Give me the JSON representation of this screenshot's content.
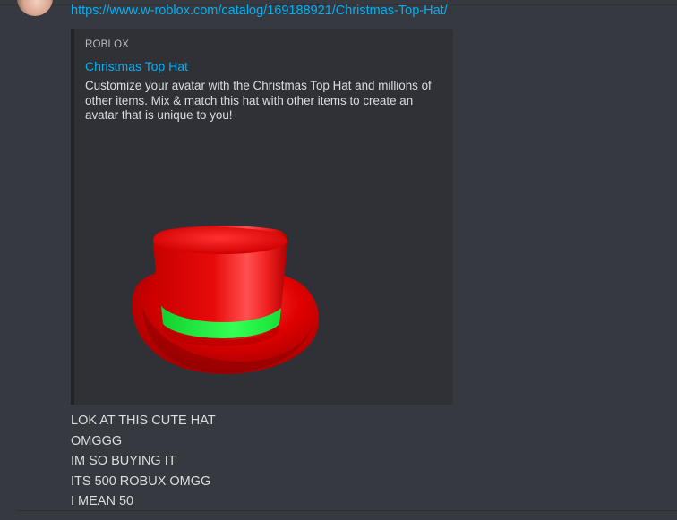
{
  "message": {
    "link_url": "https://www.w-roblox.com/catalog/169188921/Christmas-Top-Hat/",
    "lines": [
      "LOK AT THIS CUTE HAT",
      "OMGGG",
      "IM SO BUYING IT",
      "ITS 500 ROBUX OMGG",
      "I MEAN 50"
    ]
  },
  "embed": {
    "provider": "ROBLOX",
    "title": "Christmas Top Hat",
    "description": "Customize your avatar with the Christmas Top Hat and millions of other items. Mix & match this hat with other items to create an avatar that is unique to you!",
    "image_alt": "red top hat with green band"
  },
  "colors": {
    "background": "#36393f",
    "embed_background": "#2f3136",
    "link": "#00b0f4",
    "text": "#dcddde",
    "hat_red": "#e00000",
    "hat_band": "#22ff44"
  }
}
